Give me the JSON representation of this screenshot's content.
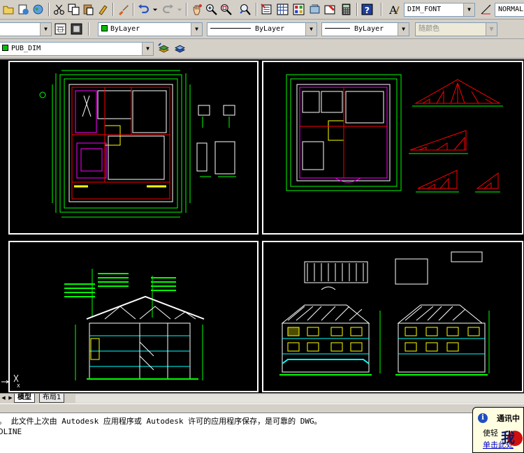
{
  "toolbar_top": {
    "icons": [
      "open-icon",
      "publish-icon",
      "globe-icon",
      "cut-icon",
      "copy-icon",
      "paste-icon",
      "match-properties-icon",
      "brush-icon",
      "undo-icon",
      "redo-icon",
      "pan-icon",
      "zoom-realtime-icon",
      "zoom-window-icon",
      "zoom-previous-icon",
      "properties-icon",
      "design-center-icon",
      "tool-palettes-icon",
      "sheet-set-icon",
      "markup-icon",
      "calculator-icon",
      "help-icon"
    ],
    "text_style_icon": "text-style-icon",
    "text_style_value": "DIM_FONT",
    "dim_style_icon": "dim-style-icon",
    "dim_style_value": "NORMAL"
  },
  "toolbar_properties": {
    "layer_combo_value": "",
    "color_value": "ByLayer",
    "color_swatch": "#00c000",
    "linetype_value": "ByLayer",
    "lineweight_value": "ByLayer",
    "plotstyle_value": "随颜色"
  },
  "toolbar_layers": {
    "layer_value": "PUB_DIM",
    "layer_swatch": "#00c000",
    "layer_icons": [
      "layer-previous-icon",
      "layer-states-icon"
    ]
  },
  "layout_tabs": {
    "nav_icons": [
      "first-tab-icon",
      "prev-tab-icon",
      "next-tab-icon",
      "last-tab-icon"
    ],
    "tabs": [
      "模型",
      "布局1"
    ],
    "active": "模型"
  },
  "command": {
    "line1": "。  此文件上次由 Autodesk 应用程序或 Autodesk 许可的应用程序保存，是可靠的 DWG。",
    "line2": "DLINE"
  },
  "notification": {
    "title": "通讯中",
    "body": "使轻",
    "link": "单击此处"
  },
  "colors": {
    "cad_background": "#000000",
    "cad_white": "#ffffff",
    "cad_green": "#00ff00",
    "cad_magenta": "#ff00ff",
    "cad_yellow": "#ffff00",
    "cad_red": "#ff0000",
    "cad_cyan": "#00ffff"
  }
}
